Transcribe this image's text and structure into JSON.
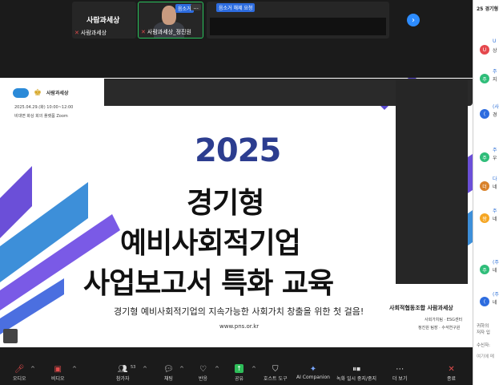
{
  "participants": {
    "tile1": {
      "name_big": "사람과세상",
      "label": "사람과세상"
    },
    "tile2": {
      "badge": "음소거",
      "dots": "...",
      "label": "사람과세상_정진원"
    },
    "tile3": {
      "badge": "음소거 해제 요청"
    }
  },
  "slide": {
    "logo_text": "사람과세상",
    "date": "2025.04.29.(화) 10:00~12:00",
    "place": "비대면 화상 회의 플랫폼 Zoom",
    "year": "2025",
    "title1": "경기형",
    "title2": "예비사회적기업",
    "title3": "사업보고서 특화 교육",
    "subtitle": "경기형 예비사회적기업의 지속가능한 사회가치 창출을 위한 첫 걸음!",
    "url": "www.pns.or.kr",
    "org": "사회적협동조합 사람과세상",
    "org_sub1": "사회가치팀 · ESG센터",
    "org_sub2": "정진원 팀장 · 수석연구원",
    "colors": {
      "year": "#2c3d8f",
      "stripe_purple": "#6b4fd8",
      "stripe_blue": "#3d8fd9"
    }
  },
  "toolbar": {
    "mute": "오디오",
    "video": "비디오",
    "participants": "참가자",
    "participants_count": "53",
    "chat": "채팅",
    "react": "반응",
    "share": "공유",
    "host_tools": "호스트 도구",
    "ai": "AI Companion",
    "record": "녹화 일시 중지/중지",
    "more": "더 보기",
    "end": "종료",
    "colors": {
      "accent": "#2ebd59",
      "danger": "#e04b4b"
    }
  },
  "chat": {
    "title": "25 경기형",
    "messages": [
      {
        "avatar": "U",
        "color": "#e5484d",
        "sender": "U",
        "text": "상"
      },
      {
        "avatar": "주",
        "color": "#2ebd79",
        "sender": "주",
        "text": "지"
      },
      {
        "avatar": "(",
        "color": "#2d6cdf",
        "sender": "(사",
        "text": "경"
      },
      {
        "avatar": "주",
        "color": "#2ebd79",
        "sender": "주",
        "text": "우"
      },
      {
        "avatar": "더",
        "color": "#d9822b",
        "sender": "다",
        "text": "네"
      },
      {
        "avatar": "왕",
        "color": "#f5a623",
        "sender": "주",
        "text": "네"
      },
      {
        "avatar": "주",
        "color": "#2ebd79",
        "sender": "(주",
        "text": "네"
      },
      {
        "avatar": "(",
        "color": "#2d6cdf",
        "sender": "(주",
        "text": "네"
      }
    ],
    "footer1": "귀하의",
    "footer2": "저자 입",
    "recipient": "수신자:",
    "input_placeholder": "여기에 메"
  }
}
